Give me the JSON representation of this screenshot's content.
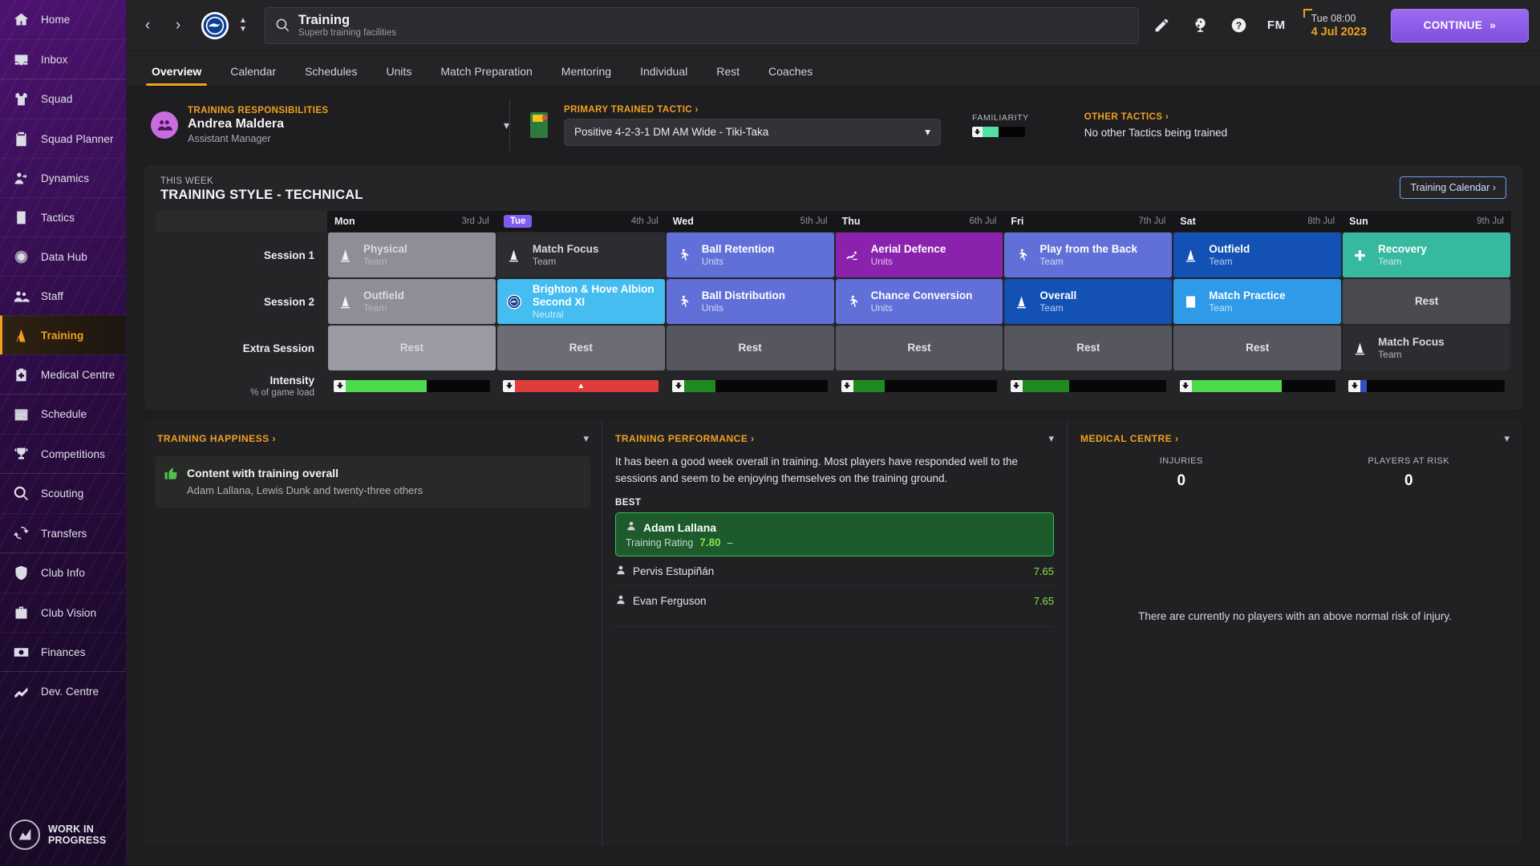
{
  "sidebar": {
    "groups": [
      {
        "items": [
          {
            "label": "Home",
            "icon": "home-icon"
          },
          {
            "label": "Inbox",
            "icon": "inbox-icon"
          }
        ]
      },
      {
        "items": [
          {
            "label": "Squad",
            "icon": "shirt-icon"
          },
          {
            "label": "Squad Planner",
            "icon": "clipboard-icon"
          },
          {
            "label": "Dynamics",
            "icon": "dynamics-icon"
          },
          {
            "label": "Tactics",
            "icon": "tactics-icon"
          },
          {
            "label": "Data Hub",
            "icon": "datahub-icon"
          },
          {
            "label": "Staff",
            "icon": "staff-icon"
          },
          {
            "label": "Training",
            "icon": "training-icon",
            "active": true
          },
          {
            "label": "Medical Centre",
            "icon": "medical-icon"
          }
        ]
      },
      {
        "items": [
          {
            "label": "Schedule",
            "icon": "calendar-icon"
          },
          {
            "label": "Competitions",
            "icon": "trophy-icon"
          }
        ]
      },
      {
        "items": [
          {
            "label": "Scouting",
            "icon": "magnifier-icon"
          },
          {
            "label": "Transfers",
            "icon": "transfer-icon"
          }
        ]
      },
      {
        "items": [
          {
            "label": "Club Info",
            "icon": "shield-icon"
          },
          {
            "label": "Club Vision",
            "icon": "briefcase-icon"
          },
          {
            "label": "Finances",
            "icon": "money-icon"
          }
        ]
      },
      {
        "items": [
          {
            "label": "Dev. Centre",
            "icon": "growth-icon"
          }
        ]
      }
    ],
    "watermark": {
      "line1": "WORK IN",
      "line2": "PROGRESS"
    }
  },
  "titlebar": {
    "back_label": "‹",
    "forward_label": "›",
    "search_title": "Training",
    "search_subtitle": "Superb training facilities",
    "search_placeholder": "Search",
    "fm_label": "FM",
    "date_time": "Tue 08:00",
    "date_day": "4 Jul 2023",
    "continue_label": "CONTINUE",
    "continue_arrow": "»",
    "icons": [
      "pencil-icon",
      "globe-icon",
      "help-icon"
    ]
  },
  "tabs": [
    {
      "label": "Overview",
      "active": true
    },
    {
      "label": "Calendar"
    },
    {
      "label": "Schedules"
    },
    {
      "label": "Units"
    },
    {
      "label": "Match Preparation"
    },
    {
      "label": "Mentoring"
    },
    {
      "label": "Individual"
    },
    {
      "label": "Rest"
    },
    {
      "label": "Coaches"
    }
  ],
  "responsibilities": {
    "label": "TRAINING RESPONSIBILITIES",
    "name": "Andrea Maldera",
    "role": "Assistant Manager"
  },
  "primary_tactic": {
    "label": "PRIMARY TRAINED TACTIC ›",
    "value": "Positive 4-2-3-1 DM AM Wide - Tiki-Taka",
    "familiarity_label": "FAMILIARITY",
    "familiarity_percent": 38
  },
  "other_tactics": {
    "label": "OTHER TACTICS ›",
    "text": "No other Tactics being trained"
  },
  "week": {
    "eyebrow": "THIS WEEK",
    "title": "TRAINING STYLE - TECHNICAL",
    "calendar_button": "Training Calendar ›",
    "days": [
      {
        "name": "Mon",
        "date": "3rd Jul",
        "today": false
      },
      {
        "name": "Tue",
        "date": "4th Jul",
        "today": true
      },
      {
        "name": "Wed",
        "date": "5th Jul",
        "today": false
      },
      {
        "name": "Thu",
        "date": "6th Jul",
        "today": false
      },
      {
        "name": "Fri",
        "date": "7th Jul",
        "today": false
      },
      {
        "name": "Sat",
        "date": "8th Jul",
        "today": false
      },
      {
        "name": "Sun",
        "date": "9th Jul",
        "today": false
      }
    ],
    "rows": [
      {
        "label": "Session 1",
        "sub": ""
      },
      {
        "label": "Session 2",
        "sub": ""
      },
      {
        "label": "Extra Session",
        "sub": ""
      },
      {
        "label": "Intensity",
        "sub": "% of game load"
      }
    ],
    "session1": [
      {
        "name": "Physical",
        "type": "Team",
        "icon": "cone-icon",
        "color": "#8e8e98",
        "dim": true
      },
      {
        "name": "Match Focus",
        "type": "Team",
        "icon": "cone-icon",
        "color": "#2c2c31",
        "dim": true
      },
      {
        "name": "Ball Retention",
        "type": "Units",
        "icon": "player-icon",
        "color": "#6070d8"
      },
      {
        "name": "Aerial Defence",
        "type": "Units",
        "icon": "dive-icon",
        "color": "#8a22ad"
      },
      {
        "name": "Play from the Back",
        "type": "Team",
        "icon": "player-icon",
        "color": "#6070d8"
      },
      {
        "name": "Outfield",
        "type": "Team",
        "icon": "cone-icon",
        "color": "#1351b5"
      },
      {
        "name": "Recovery",
        "type": "Team",
        "icon": "recovery-icon",
        "color": "#37b9a0"
      }
    ],
    "session2": [
      {
        "name": "Outfield",
        "type": "Team",
        "icon": "cone-icon",
        "color": "#8e8e98",
        "dim": true
      },
      {
        "name": "Brighton & Hove Albion Second XI",
        "type": "Neutral",
        "icon": "club-badge-icon",
        "color": "#45bdf0",
        "match": true
      },
      {
        "name": "Ball Distribution",
        "type": "Units",
        "icon": "player-icon",
        "color": "#6070d8"
      },
      {
        "name": "Chance Conversion",
        "type": "Units",
        "icon": "player-icon",
        "color": "#6070d8"
      },
      {
        "name": "Overall",
        "type": "Team",
        "icon": "cone-icon",
        "color": "#1351b5"
      },
      {
        "name": "Match Practice",
        "type": "Team",
        "icon": "doc-icon",
        "color": "#2f9ae8"
      },
      {
        "name": "Rest",
        "type": "",
        "icon": "",
        "color": "#4a4a51",
        "rest": true
      }
    ],
    "extra": [
      {
        "name": "Rest",
        "type": "",
        "icon": "",
        "color": "#9a9aa3",
        "rest": true,
        "dim": true
      },
      {
        "name": "Rest",
        "type": "",
        "icon": "",
        "color": "#6c6c75",
        "rest": true
      },
      {
        "name": "Rest",
        "type": "",
        "icon": "",
        "color": "#56565e",
        "rest": true
      },
      {
        "name": "Rest",
        "type": "",
        "icon": "",
        "color": "#56565e",
        "rest": true
      },
      {
        "name": "Rest",
        "type": "",
        "icon": "",
        "color": "#56565e",
        "rest": true
      },
      {
        "name": "Rest",
        "type": "",
        "icon": "",
        "color": "#56565e",
        "rest": true
      },
      {
        "name": "Match Focus",
        "type": "Team",
        "icon": "cone-icon",
        "color": "#2c2c31",
        "dim": true
      }
    ],
    "intensity": [
      {
        "percent": 52,
        "color": "#4ddb4d",
        "warn": false
      },
      {
        "percent": 100,
        "color": "#e03c3c",
        "warn": true
      },
      {
        "percent": 20,
        "color": "#1f8a1f",
        "warn": false
      },
      {
        "percent": 20,
        "color": "#1f8a1f",
        "warn": false
      },
      {
        "percent": 30,
        "color": "#1f8a1f",
        "warn": false
      },
      {
        "percent": 58,
        "color": "#4ddb4d",
        "warn": false
      },
      {
        "percent": 4,
        "color": "#3050c8",
        "warn": false
      }
    ]
  },
  "training_happiness": {
    "title": "TRAINING HAPPINESS ›",
    "status": "Content with training overall",
    "players": "Adam Lallana, Lewis Dunk and twenty-three others"
  },
  "training_performance": {
    "title": "TRAINING PERFORMANCE ›",
    "summary": "It has been a good week overall in training. Most players have responded well to the sessions and seem to be enjoying themselves on the training ground.",
    "best_label": "BEST",
    "best": {
      "name": "Adam Lallana",
      "rating_label": "Training Rating",
      "rating": "7.80",
      "trend": "–"
    },
    "others": [
      {
        "name": "Pervis Estupiñán",
        "rating": "7.65"
      },
      {
        "name": "Evan Ferguson",
        "rating": "7.65"
      }
    ]
  },
  "medical_centre": {
    "title": "MEDICAL CENTRE ›",
    "injuries_label": "INJURIES",
    "injuries_value": "0",
    "risk_label": "PLAYERS AT RISK",
    "risk_value": "0",
    "note": "There are currently no players with an above normal risk of injury."
  },
  "colors": {
    "accent_orange": "#f0a020",
    "purple": "#7f5cf0",
    "green": "#4ddb4d",
    "red": "#e03c3c"
  }
}
